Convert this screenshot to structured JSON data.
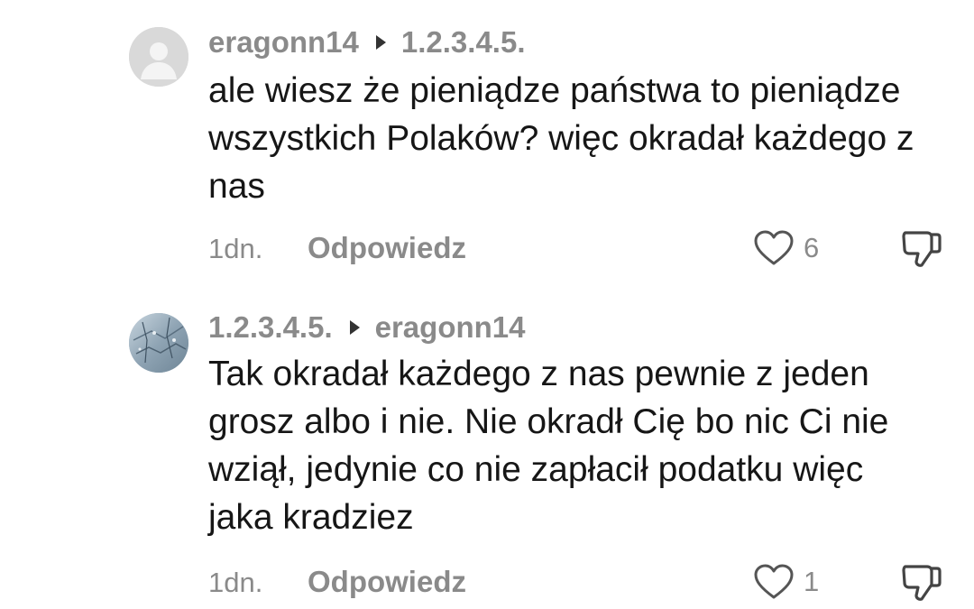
{
  "comments": [
    {
      "author": "eragonn14",
      "reply_to": "1.2.3.4.5.",
      "text": "ale wiesz że pieniądze państwa to pieniądze wszystkich Polaków? więc okradał każdego z nas",
      "time": "1dn.",
      "reply_label": "Odpowiedz",
      "likes": "6",
      "avatar": "default-avatar-icon"
    },
    {
      "author": "1.2.3.4.5.",
      "reply_to": "eragonn14",
      "text": "Tak okradał każdego z nas pewnie z jeden grosz albo i nie. Nie okradł Cię bo nic Ci nie wziął, jedynie co nie zapłacił podatku więc jaka kradziez",
      "time": "1dn.",
      "reply_label": "Odpowiedz",
      "likes": "1",
      "avatar": "photo-avatar"
    }
  ],
  "colors": {
    "meta_gray": "#8a8a8a",
    "text": "#161616",
    "background": "#ffffff"
  }
}
